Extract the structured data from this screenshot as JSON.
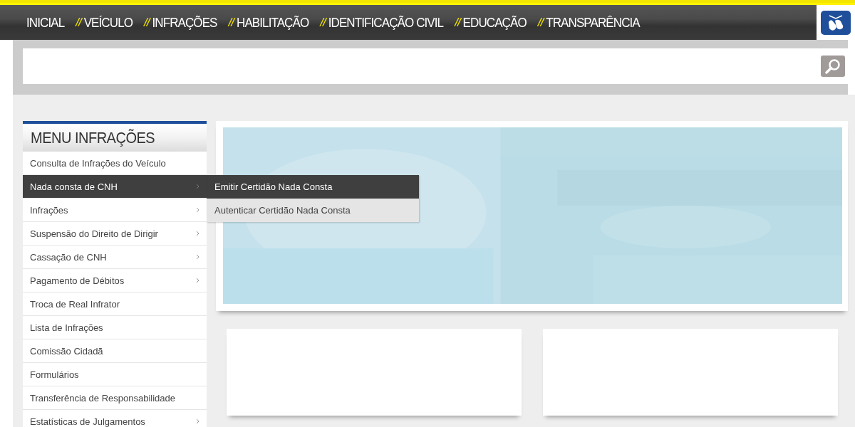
{
  "nav": {
    "items": [
      {
        "label": "INICIAL"
      },
      {
        "separator": "//",
        "label": "VEÍCULO"
      },
      {
        "separator": "//",
        "label": "INFRAÇÕES"
      },
      {
        "separator": "//",
        "label": "HABILITAÇÃO"
      },
      {
        "separator": "//",
        "label": "IDENTIFICAÇÃO CIVIL"
      },
      {
        "separator": "//",
        "label": "EDUCAÇÃO"
      },
      {
        "separator": "//",
        "label": "TRANSPARÊNCIA"
      }
    ]
  },
  "sidebar": {
    "title": "MENU INFRAÇÕES",
    "items": [
      {
        "label": "Consulta de Infrações do Veículo",
        "selected": false,
        "has_submenu": false
      },
      {
        "label": "Nada consta de CNH",
        "selected": true,
        "has_submenu": true
      },
      {
        "label": "Infrações",
        "selected": false,
        "has_submenu": true
      },
      {
        "label": "Suspensão do Direito de Dirigir",
        "selected": false,
        "has_submenu": true
      },
      {
        "label": "Cassação de CNH",
        "selected": false,
        "has_submenu": true
      },
      {
        "label": "Pagamento de Débitos",
        "selected": false,
        "has_submenu": true
      },
      {
        "label": "Troca de Real Infrator",
        "selected": false,
        "has_submenu": false
      },
      {
        "label": "Lista de Infrações",
        "selected": false,
        "has_submenu": false
      },
      {
        "label": "Comissão Cidadã",
        "selected": false,
        "has_submenu": false
      },
      {
        "label": "Formulários",
        "selected": false,
        "has_submenu": false
      },
      {
        "label": "Transferência de Responsabilidade",
        "selected": false,
        "has_submenu": false
      },
      {
        "label": "Estatísticas de Julgamentos",
        "selected": false,
        "has_submenu": true
      }
    ]
  },
  "submenu": {
    "items": [
      {
        "label": "Emitir Certidão Nada Consta",
        "selected": true
      },
      {
        "label": "Autenticar Certidão Nada Consta",
        "selected": false
      }
    ]
  }
}
